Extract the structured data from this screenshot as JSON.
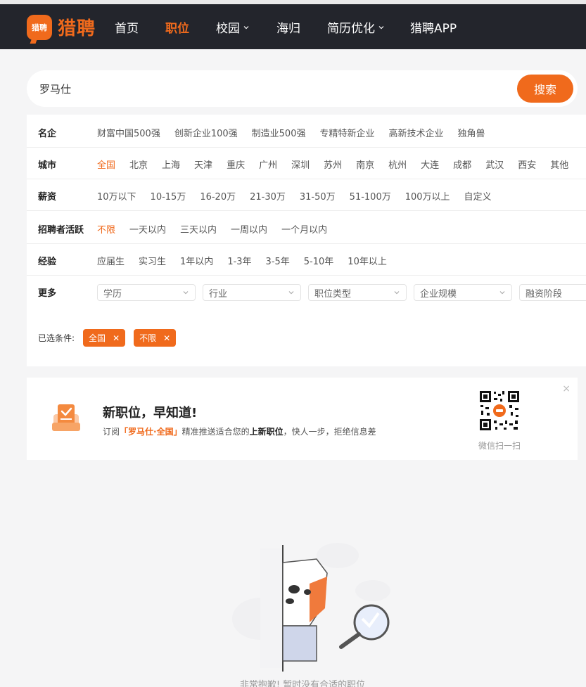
{
  "nav": {
    "logo_badge": "猎聘",
    "logo_text": "猎聘",
    "items": [
      {
        "label": "首页"
      },
      {
        "label": "职位"
      },
      {
        "label": "校园"
      },
      {
        "label": "海归"
      },
      {
        "label": "简历优化"
      },
      {
        "label": "猎聘APP"
      }
    ]
  },
  "search": {
    "value": "罗马仕",
    "button": "搜索"
  },
  "filters": {
    "famous": {
      "label": "名企",
      "options": [
        "财富中国500强",
        "创新企业100强",
        "制造业500强",
        "专精特新企业",
        "高新技术企业",
        "独角兽"
      ]
    },
    "city": {
      "label": "城市",
      "options": [
        "全国",
        "北京",
        "上海",
        "天津",
        "重庆",
        "广州",
        "深圳",
        "苏州",
        "南京",
        "杭州",
        "大连",
        "成都",
        "武汉",
        "西安",
        "其他"
      ]
    },
    "salary": {
      "label": "薪资",
      "options": [
        "10万以下",
        "10-15万",
        "16-20万",
        "21-30万",
        "31-50万",
        "51-100万",
        "100万以上",
        "自定义"
      ]
    },
    "active": {
      "label": "招聘者活跃",
      "options": [
        "不限",
        "一天以内",
        "三天以内",
        "一周以内",
        "一个月以内"
      ]
    },
    "experience": {
      "label": "经验",
      "options": [
        "应届生",
        "实习生",
        "1年以内",
        "1-3年",
        "3-5年",
        "5-10年",
        "10年以上"
      ]
    },
    "more": {
      "label": "更多",
      "dropdowns": [
        "学历",
        "行业",
        "职位类型",
        "企业规模",
        "融资阶段"
      ]
    },
    "chosen": {
      "label": "已选条件:",
      "tags": [
        "全国",
        "不限"
      ]
    }
  },
  "promo": {
    "title": "新职位，早知道!",
    "sub_prefix": "订阅",
    "sub_highlight": "「罗马仕·全国」",
    "sub_mid": "精准推送适合您的",
    "sub_bold": "上新职位",
    "sub_suffix": "，快人一步，拒绝信息差",
    "qr_label": "微信扫一扫",
    "close": "×"
  },
  "empty": {
    "text": "非常抱歉! 暂时没有合适的职位"
  },
  "colors": {
    "accent": "#f06a1c",
    "navbar": "#23252c"
  }
}
